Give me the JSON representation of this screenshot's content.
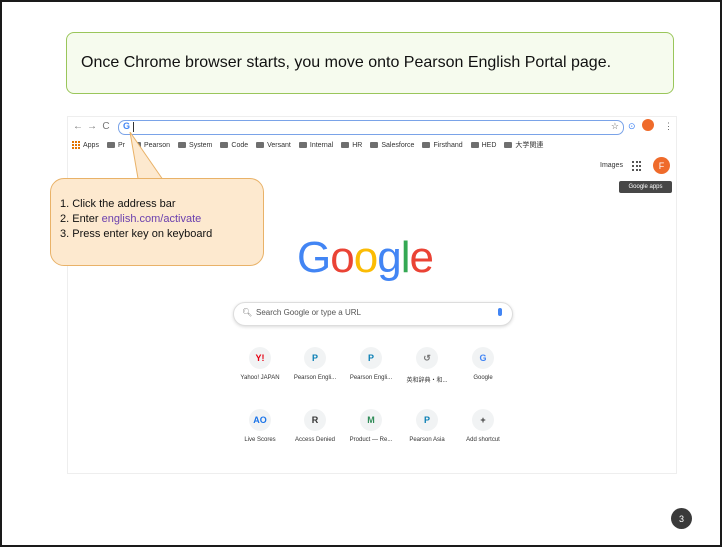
{
  "instruction": "Once Chrome browser starts, you move onto Pearson English Portal page.",
  "browser": {
    "nav": [
      "←",
      "→",
      "C"
    ],
    "address_prefix": "G",
    "bookmark_star": "☆",
    "bookmarks": [
      "Apps",
      "Pr",
      "Pearson",
      "System",
      "Code",
      "Versant",
      "Internal",
      "HR",
      "Salesforce",
      "Firsthand",
      "HED",
      "大学関連"
    ]
  },
  "google": {
    "images_link": "Images",
    "avatar_letter": "F",
    "tooltip": "Google apps",
    "logo_letters": [
      "G",
      "o",
      "o",
      "g",
      "l",
      "e"
    ],
    "search_placeholder": "Search Google or type a URL",
    "shortcuts_row1": [
      {
        "icon": "Y!",
        "label": "Yahoo! JAPAN",
        "color": "#e60012"
      },
      {
        "icon": "P",
        "label": "Pearson Engli...",
        "color": "#0a7fb5"
      },
      {
        "icon": "P",
        "label": "Pearson Engli...",
        "color": "#0a7fb5"
      },
      {
        "icon": "↺",
        "label": "英和辞典・和...",
        "color": "#777777"
      },
      {
        "icon": "G",
        "label": "Google",
        "color": "#4285f4"
      }
    ],
    "shortcuts_row2": [
      {
        "icon": "AO",
        "label": "Live Scores",
        "color": "#1a73e8"
      },
      {
        "icon": "R",
        "label": "Access Denied",
        "color": "#333333"
      },
      {
        "icon": "M",
        "label": "Product — Re...",
        "color": "#2e8b57"
      },
      {
        "icon": "P",
        "label": "Pearson Asia",
        "color": "#0a7fb5"
      },
      {
        "icon": "+",
        "label": "Add shortcut",
        "color": "#333333"
      }
    ]
  },
  "steps": {
    "step1": "1. Click the address bar",
    "step2_prefix": "2. Enter ",
    "step2_link": "english.com/activate",
    "step3": "3. Press enter key on keyboard"
  },
  "page_number": "3"
}
